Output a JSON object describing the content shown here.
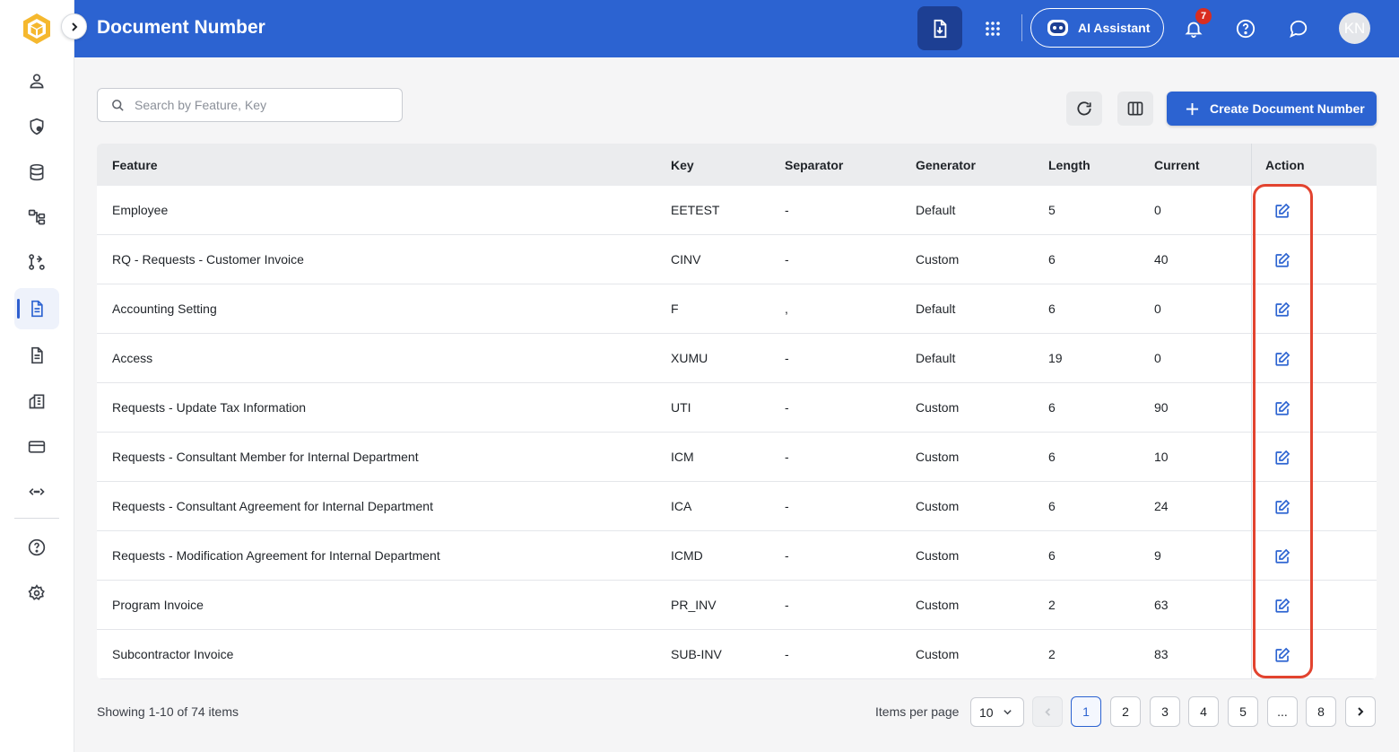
{
  "header": {
    "title": "Document Number",
    "ai_assistant_label": "AI Assistant",
    "notification_count": "7",
    "avatar_initials": "KN"
  },
  "sidebar": {
    "items": [
      {
        "icon": "user-icon"
      },
      {
        "icon": "shield-user-icon"
      },
      {
        "icon": "database-icon"
      },
      {
        "icon": "hierarchy-icon"
      },
      {
        "icon": "workflow-icon"
      },
      {
        "icon": "document-number-icon",
        "active": true
      },
      {
        "icon": "document-icon"
      },
      {
        "icon": "building-icon"
      },
      {
        "icon": "credit-card-icon"
      },
      {
        "icon": "code-arrows-icon"
      },
      {
        "icon": "help-icon"
      },
      {
        "icon": "settings-icon"
      }
    ]
  },
  "toolbar": {
    "search_placeholder": "Search by Feature, Key",
    "create_label": "Create Document Number"
  },
  "table": {
    "columns": [
      "Feature",
      "Key",
      "Separator",
      "Generator",
      "Length",
      "Current",
      "Action"
    ],
    "rows": [
      {
        "feature": "Employee",
        "key": "EETEST",
        "separator": "-",
        "generator": "Default",
        "length": "5",
        "current": "0"
      },
      {
        "feature": "RQ - Requests - Customer Invoice",
        "key": "CINV",
        "separator": "-",
        "generator": "Custom",
        "length": "6",
        "current": "40"
      },
      {
        "feature": "Accounting Setting",
        "key": "F",
        "separator": ",",
        "generator": "Default",
        "length": "6",
        "current": "0"
      },
      {
        "feature": "Access",
        "key": "XUMU",
        "separator": "-",
        "generator": "Default",
        "length": "19",
        "current": "0"
      },
      {
        "feature": "Requests - Update Tax Information",
        "key": "UTI",
        "separator": "-",
        "generator": "Custom",
        "length": "6",
        "current": "90"
      },
      {
        "feature": "Requests - Consultant Member for Internal Department",
        "key": "ICM",
        "separator": "-",
        "generator": "Custom",
        "length": "6",
        "current": "10"
      },
      {
        "feature": "Requests - Consultant Agreement for Internal Department",
        "key": "ICA",
        "separator": "-",
        "generator": "Custom",
        "length": "6",
        "current": "24"
      },
      {
        "feature": "Requests - Modification Agreement for Internal Department",
        "key": "ICMD",
        "separator": "-",
        "generator": "Custom",
        "length": "6",
        "current": "9"
      },
      {
        "feature": "Program Invoice",
        "key": "PR_INV",
        "separator": "-",
        "generator": "Custom",
        "length": "2",
        "current": "63"
      },
      {
        "feature": "Subcontractor Invoice",
        "key": "SUB-INV",
        "separator": "-",
        "generator": "Custom",
        "length": "2",
        "current": "83"
      }
    ]
  },
  "footer": {
    "showing_text": "Showing 1-10 of 74 items",
    "items_per_page_label": "Items per page",
    "items_per_page_value": "10",
    "pages": [
      "1",
      "2",
      "3",
      "4",
      "5",
      "...",
      "8"
    ],
    "current_page": "1"
  },
  "colors": {
    "header_bg": "#2c63d1",
    "accent": "#2c63d1",
    "highlight": "#e2432f",
    "badge": "#d92d20"
  }
}
